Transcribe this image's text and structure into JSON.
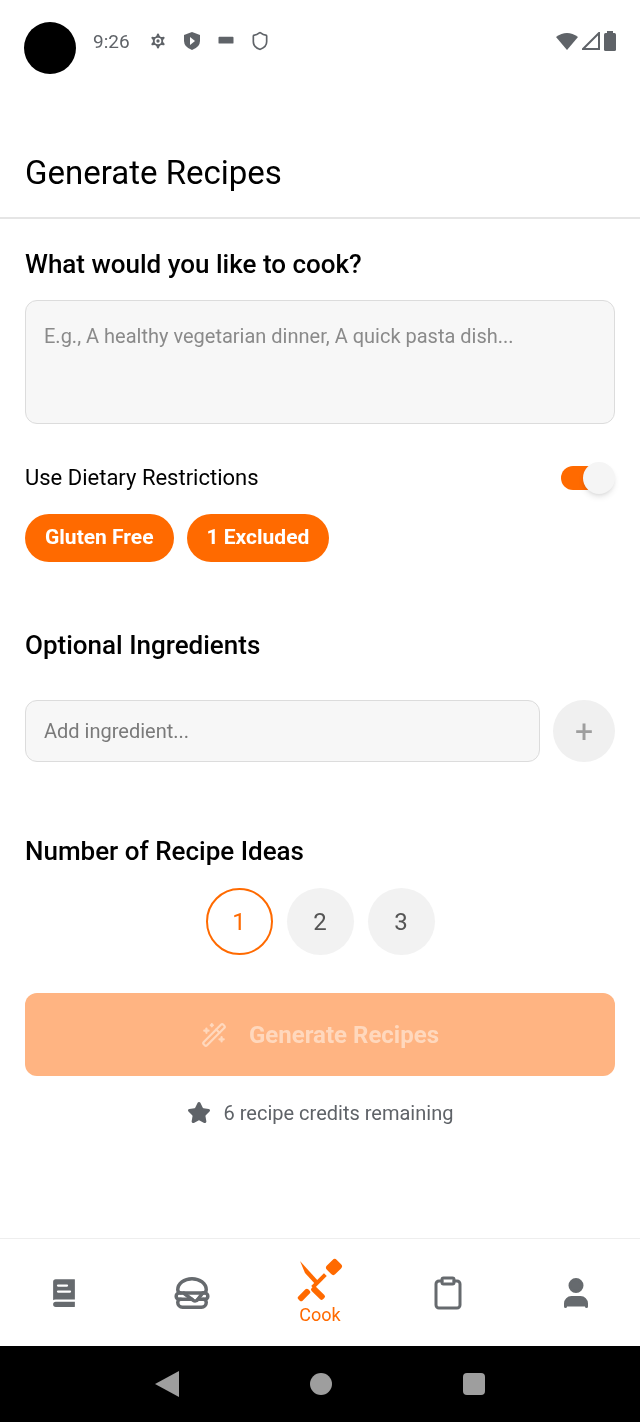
{
  "status_bar": {
    "time": "9:26"
  },
  "header": {
    "title": "Generate Recipes"
  },
  "prompt": {
    "heading": "What would you like to cook?",
    "placeholder": "E.g., A healthy vegetarian dinner, A quick pasta dish..."
  },
  "dietary": {
    "label": "Use Dietary Restrictions",
    "on": true,
    "chips": [
      "Gluten Free",
      "1 Excluded"
    ]
  },
  "ingredients": {
    "heading": "Optional Ingredients",
    "placeholder": "Add ingredient...",
    "add_button": "+"
  },
  "count": {
    "heading": "Number of Recipe Ideas",
    "options": [
      {
        "label": "1",
        "selected": true
      },
      {
        "label": "2",
        "selected": false
      },
      {
        "label": "3",
        "selected": false
      }
    ]
  },
  "generate": {
    "label": "Generate Recipes",
    "disabled": true
  },
  "credits": "6 recipe credits remaining",
  "bottom_nav": [
    {
      "kind": "book",
      "selected": false
    },
    {
      "kind": "burger",
      "selected": false
    },
    {
      "kind": "cook",
      "label": "Cook",
      "selected": true
    },
    {
      "kind": "clipboard",
      "selected": false
    },
    {
      "kind": "person",
      "selected": false
    }
  ]
}
